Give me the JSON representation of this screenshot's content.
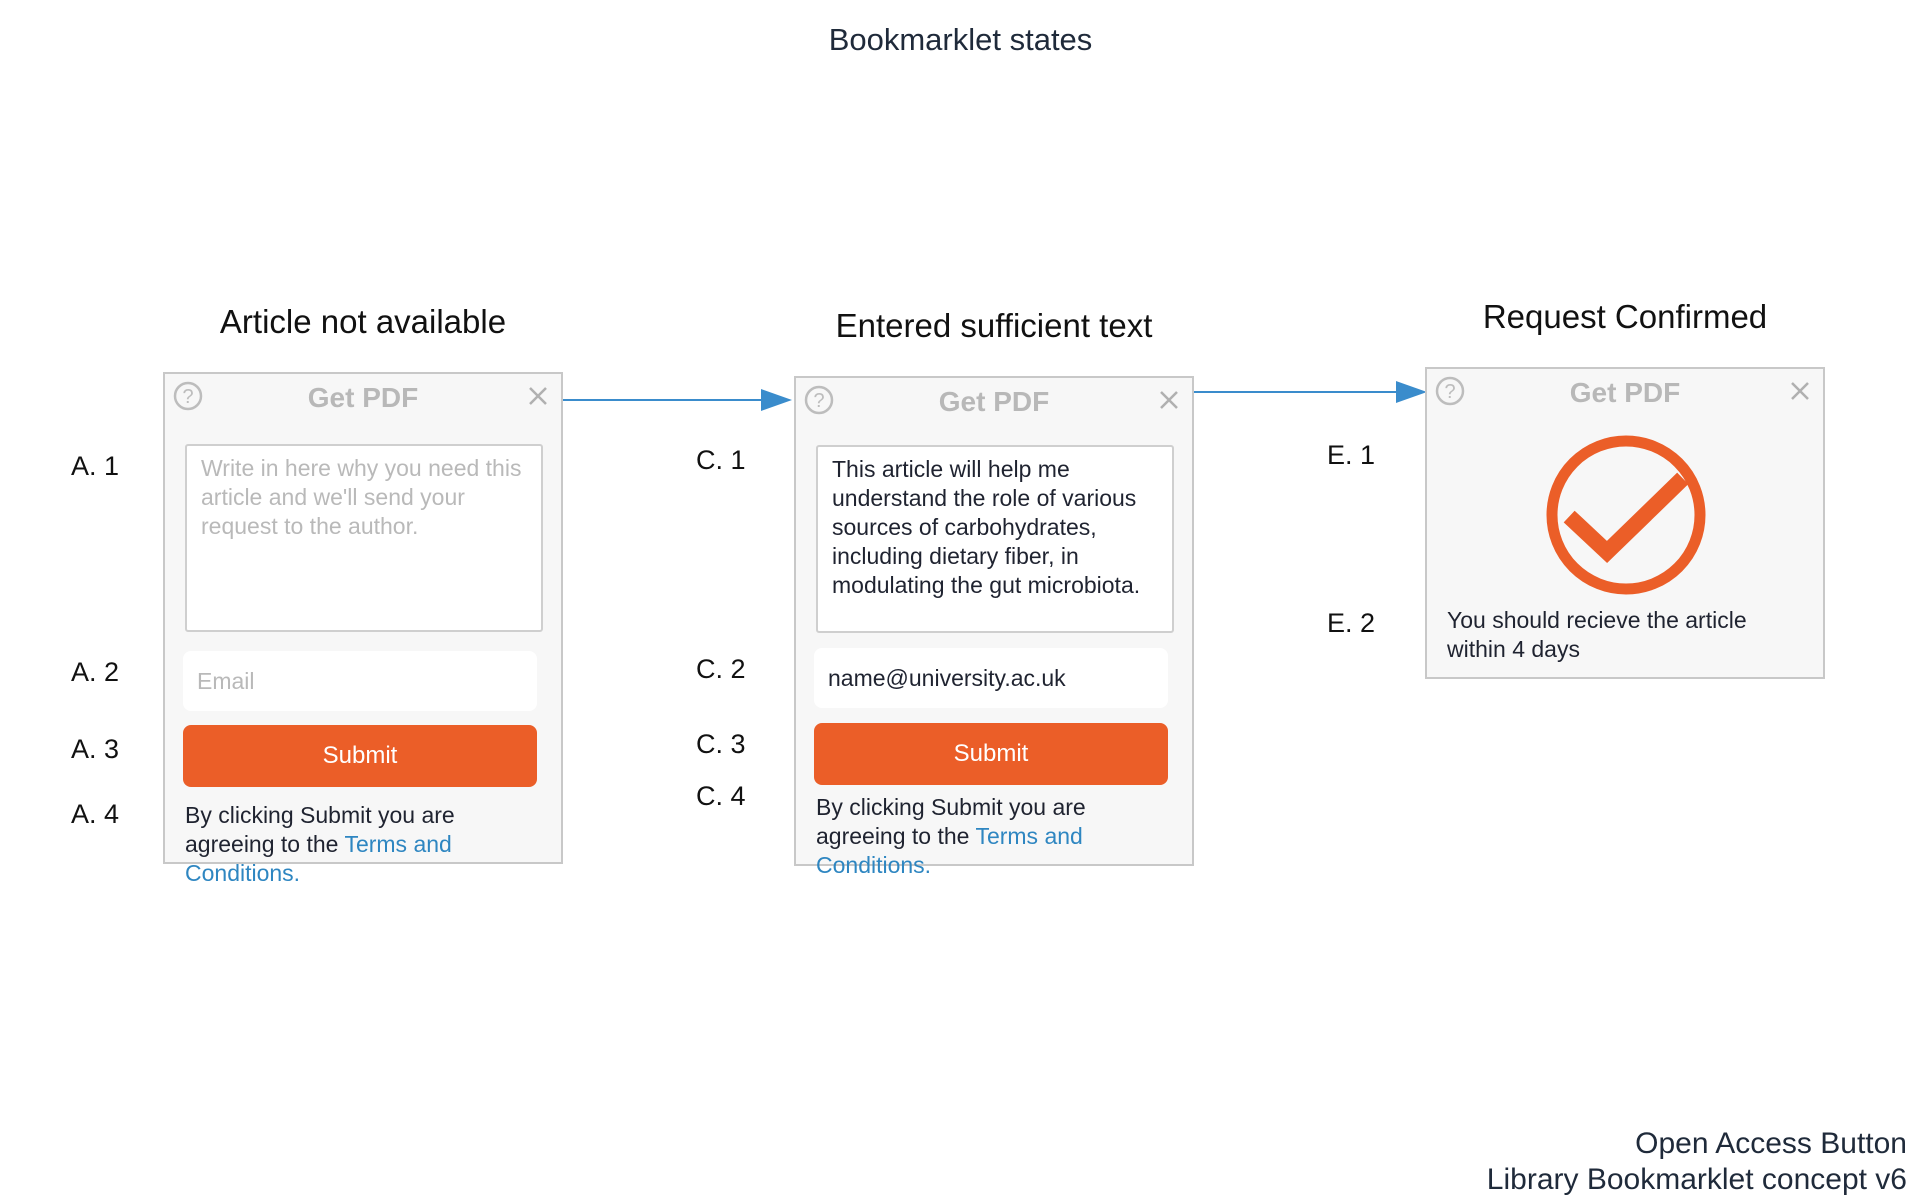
{
  "page_title": "Bookmarklet states",
  "footer": {
    "line1": "Open Access Button",
    "line2": "Library Bookmarklet concept v6"
  },
  "colors": {
    "accent": "#eb5e28",
    "link": "#2e86c1",
    "arrow": "#3a8ccc",
    "panel_bg": "#f7f7f7",
    "panel_border": "#c8c8c8"
  },
  "states": [
    {
      "title": "Article not available",
      "panel_title": "Get PDF",
      "help_icon": "question-circle-icon",
      "close_icon": "close-icon",
      "labels": [
        "A. 1",
        "A. 2",
        "A. 3",
        "A. 4"
      ],
      "reason_placeholder": "Write in here why you need this article and we'll send your request to the author.",
      "email_placeholder": "Email",
      "submit_label": "Submit",
      "terms_prefix": "By clicking Submit you are agreeing to the ",
      "terms_link": "Terms and Conditions."
    },
    {
      "title": "Entered sufficient text",
      "panel_title": "Get PDF",
      "help_icon": "question-circle-icon",
      "close_icon": "close-icon",
      "labels": [
        "C. 1",
        "C. 2",
        "C. 3",
        "C. 4"
      ],
      "reason_value": "This article will help me understand the role of various sources of carbohydrates, including dietary fiber, in modulating the gut microbiota.",
      "email_value": "name@university.ac.uk",
      "submit_label": "Submit",
      "terms_prefix": "By clicking Submit you are agreeing to the ",
      "terms_link": "Terms and Conditions."
    },
    {
      "title": "Request Confirmed",
      "panel_title": "Get PDF",
      "help_icon": "question-circle-icon",
      "close_icon": "close-icon",
      "success_icon": "check-circle-icon",
      "labels": [
        "E. 1",
        "E. 2"
      ],
      "confirmation_text": "You should recieve the article within 4 days"
    }
  ]
}
